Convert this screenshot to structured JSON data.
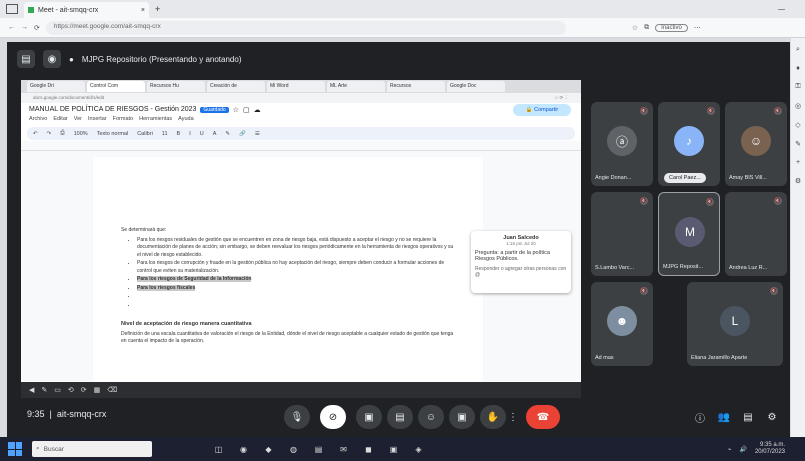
{
  "browser": {
    "tab_title": "Meet - ait-smqq-crx",
    "tab_close": "×",
    "new_tab": "+",
    "url": "https://meet.google.com/ait-smqq-crx",
    "profile_label": "Inactivo",
    "minimize": "—",
    "side_icons": [
      "⌕",
      "♦",
      "⚿",
      "◎",
      "◇",
      "✎",
      "+",
      "⚙"
    ]
  },
  "meet": {
    "title": "MJPG Repositorio (Presentando y anotando)",
    "time": "9:35",
    "meeting_code": "ait-smqq-crx"
  },
  "doc": {
    "tabs": [
      "Google Dri",
      "Control Com",
      "Recursos Hu",
      "Creación de",
      "Mi Word",
      "ML Arte",
      "Recursos",
      "Google Doc"
    ],
    "url": "docs.google.com/document/d/1/edit",
    "title": "MANUAL DE POLÍTICA DE RIESGOS - Gestión 2023",
    "saved": "Guardado",
    "menu": [
      "Archivo",
      "Editar",
      "Ver",
      "Insertar",
      "Formato",
      "Herramientas",
      "Ayuda"
    ],
    "share": "Compartir",
    "toolbar": [
      "↶",
      "↷",
      "⎙",
      "100%",
      "Texto normal",
      "Calibri",
      "11",
      "B",
      "I",
      "U",
      "A",
      "✎",
      "🔗",
      "☰"
    ],
    "intro": "Se determinará que:",
    "bullets": [
      "Para los riesgos residuales de gestión que se encuentren en zona de riesgo baja, está dispuesto a aceptar el riesgo y no se requiere la documentación de planes de acción; sin embargo, se deben reevaluar los riesgos periódicamente en la herramienta de riesgos operativos y su el nivel de riesgo establecido.",
      "Para los riesgos de corrupción y fraude en la gestión pública no hay aceptación del riesgo, siempre deben conducir a formular acciones de control que eviten su materialización."
    ],
    "highlights": [
      "Para los riesgos de Seguridad de la Información",
      "Para los riesgos fiscales"
    ],
    "heading": "Nivel de aceptación de riesgo manera cuantitativa",
    "paragraph": "Definición de una escala cuantitativa de valoración el riesgo de la Entidad, dónde el nivel de riesgo aceptable a cualquier estado de gestión que tenga en cuenta el impacto de la operación.",
    "comment": {
      "name": "Juan Salcedo",
      "date": "1:15 pm Jul 20",
      "text": "Pregunta: a partir de la política Riesgos Públicos.",
      "reply": "Responder o agregar otras personas con @"
    }
  },
  "participants": [
    {
      "name": "Angie Donan...",
      "initial": "ⓐ",
      "color": "#5f6368"
    },
    {
      "name": "Carol Paez...",
      "initial": "♪",
      "color": "#8ab4f8"
    },
    {
      "name": "Amay BIS Vill...",
      "initial": "☺",
      "color": "#7a6250"
    },
    {
      "name": "S.Lambo Varc...",
      "initial": "",
      "color": "#3c4043"
    },
    {
      "name": "MJPG Reposit...",
      "initial": "M",
      "color": "#5a5a70"
    },
    {
      "name": "Andrea Luz R...",
      "initial": "",
      "color": "#3c4043"
    },
    {
      "name": "Ad mas",
      "initial": "☻",
      "color": "#7d8ea0"
    },
    {
      "name": "Eliana Jaramillo Aparte",
      "initial": "L",
      "color": "#4a5561"
    }
  ],
  "controls": {
    "mic": "🎙",
    "cam": "⊘",
    "present": "▣",
    "captions": "▤",
    "emoji": "☺",
    "hand": "✋",
    "more": "⋮",
    "end": "☎",
    "info": "ⓘ",
    "people": "👥",
    "chat": "▤",
    "activities": "⚙"
  },
  "share_controls": [
    "◀",
    "✎",
    "▭",
    "⟲",
    "⟳",
    "▦",
    "⌫"
  ],
  "taskbar": {
    "search_placeholder": "Buscar",
    "time": "9:35 a.m.",
    "date": "20/07/2023",
    "icons": [
      "◫",
      "◉",
      "◆",
      "◍",
      "▤",
      "✉",
      "◼",
      "▣",
      "◈"
    ]
  }
}
